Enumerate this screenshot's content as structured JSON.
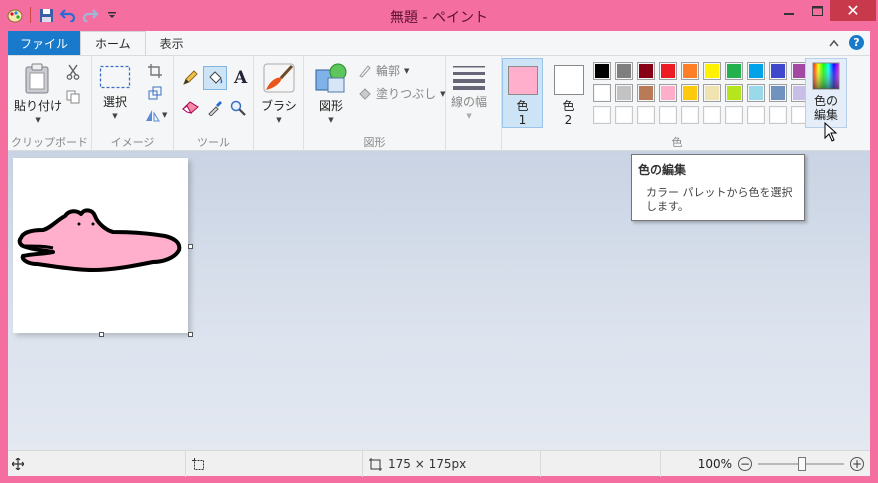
{
  "window": {
    "title": "無題 - ペイント"
  },
  "tabs": [
    {
      "label": "ファイル"
    },
    {
      "label": "ホーム"
    },
    {
      "label": "表示"
    }
  ],
  "ribbon": {
    "clipboard": {
      "paste_label": "貼り付け",
      "group_label": "クリップボード"
    },
    "image": {
      "select_label": "選択",
      "group_label": "イメージ"
    },
    "tools": {
      "group_label": "ツール"
    },
    "brushes": {
      "brush_label": "ブラシ"
    },
    "shapes": {
      "shapes_label": "図形",
      "outline_label": "輪郭",
      "fill_label": "塗りつぶし",
      "group_label": "図形"
    },
    "size": {
      "label": "線の幅"
    },
    "colors": {
      "color1_label": "色",
      "color1_number": "1",
      "color2_label": "色",
      "color2_number": "2",
      "edit_label_line1": "色の",
      "edit_label_line2": "編集",
      "group_label": "色",
      "color1_value": "#ffaecb",
      "color2_value": "#ffffff",
      "palette_row1": [
        "#000000",
        "#7f7f7f",
        "#880015",
        "#ed1c24",
        "#ff7f27",
        "#fff200",
        "#22b14c",
        "#00a2e8",
        "#3f48cc",
        "#a349a4"
      ],
      "palette_row2": [
        "#ffffff",
        "#c3c3c3",
        "#b97a57",
        "#ffaec9",
        "#ffc90e",
        "#efe4b0",
        "#b5e61d",
        "#99d9ea",
        "#7092be",
        "#c8bfe7"
      ],
      "palette_row3": [
        "#ffffff",
        "#ffffff",
        "#ffffff",
        "#ffffff",
        "#ffffff",
        "#ffffff",
        "#ffffff",
        "#ffffff",
        "#ffffff",
        "#ffffff"
      ]
    }
  },
  "tooltip": {
    "title": "色の編集",
    "body": "カラー パレットから色を選択します。"
  },
  "statusbar": {
    "size_text": "175 × 175px",
    "zoom_text": "100%"
  },
  "accent": "#1979ca",
  "window_frame": "#f46fa0"
}
